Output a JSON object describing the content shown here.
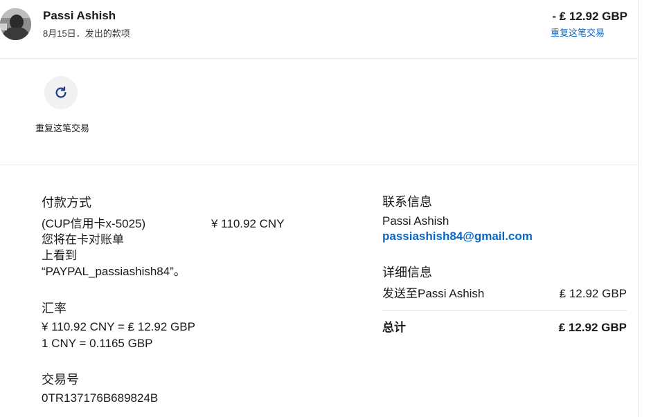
{
  "header": {
    "name": "Passi Ashish",
    "date": "8月15日",
    "separator": "．",
    "type": "发出的款项",
    "amount": "- ₤ 12.92 GBP",
    "repeat_link": "重复这笔交易"
  },
  "action": {
    "icon": "refresh-icon",
    "label": "重复这笔交易"
  },
  "payment": {
    "heading": "付款方式",
    "method": "(CUP信用卡x-5025)",
    "amount": "¥ 110.92 CNY",
    "note_lines": [
      "您将在卡对账单",
      "上看到",
      "“PAYPAL_passiashish84”。"
    ]
  },
  "exchange": {
    "heading": "汇率",
    "line1": "¥ 110.92 CNY = ₤ 12.92 GBP",
    "line2": "1 CNY = 0.1165 GBP"
  },
  "transaction": {
    "heading": "交易号",
    "id": "0TR137176B689824B"
  },
  "contact": {
    "heading": "联系信息",
    "name": "Passi Ashish",
    "email": "passiashish84@gmail.com"
  },
  "details": {
    "heading": "详细信息",
    "sent_to_label": "发送至Passi Ashish",
    "sent_to_amount": "₤ 12.92 GBP",
    "total_label": "总计",
    "total_amount": "₤ 12.92 GBP"
  },
  "colors": {
    "link": "#0a66c2",
    "text": "#1a1a1a",
    "divider": "#e6e6e6"
  }
}
